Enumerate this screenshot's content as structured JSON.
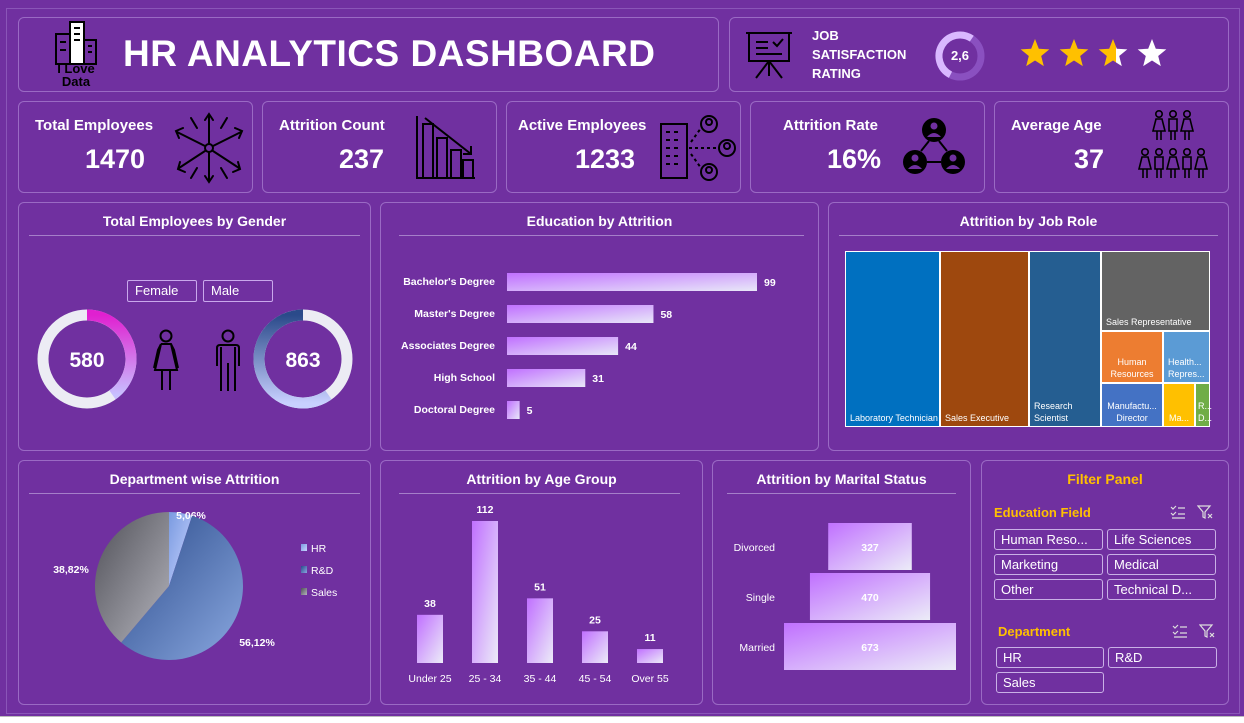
{
  "header": {
    "logo_text_line1": "I Love",
    "logo_text_line2": "Data",
    "title": "HR ANALYTICS DASHBOARD"
  },
  "job_satisfaction": {
    "label_line1": "JOB",
    "label_line2": "SATISFACTION",
    "label_line3": "RATING",
    "value": "2,6",
    "stars_filled": 2.6,
    "stars_total": 4
  },
  "kpis": [
    {
      "title": "Total Employees",
      "value": "1470",
      "icon": "team-hands-icon"
    },
    {
      "title": "Attrition Count",
      "value": "237",
      "icon": "declining-bar-chart-icon"
    },
    {
      "title": "Active Employees",
      "value": "1233",
      "icon": "office-building-people-icon"
    },
    {
      "title": "Attrition Rate",
      "value": "16%",
      "icon": "people-network-icon"
    },
    {
      "title": "Average Age",
      "value": "37",
      "icon": "people-group-icon"
    }
  ],
  "gender_panel": {
    "title": "Total Employees by Gender",
    "female_label": "Female",
    "male_label": "Male",
    "female_value": "580",
    "male_value": "863"
  },
  "education_panel": {
    "title": "Education by Attrition"
  },
  "jobrole_panel": {
    "title": "Attrition by Job Role"
  },
  "department_panel": {
    "title": "Department wise Attrition"
  },
  "age_panel": {
    "title": "Attrition by Age Group"
  },
  "marital_panel": {
    "title": "Attrition by Marital Status"
  },
  "filter_panel": {
    "title": "Filter Panel",
    "education_field_label": "Education Field",
    "education_field_options": [
      "Human Reso...",
      "Life Sciences",
      "Marketing",
      "Medical",
      "Other",
      "Technical D..."
    ],
    "department_label": "Department",
    "department_options": [
      "HR",
      "R&D",
      "Sales"
    ]
  },
  "colors": {
    "background": "#7030a0",
    "accent_orange": "#ffc000",
    "female_pink": "#e040d0",
    "male_blue": "#3a5a9a",
    "star_gold": "#ffc000"
  },
  "chart_data": [
    {
      "type": "pie",
      "chart": "gender-donuts",
      "title": "Total Employees by Gender",
      "series": [
        {
          "name": "Female",
          "value": 580
        },
        {
          "name": "Male",
          "value": 863
        }
      ]
    },
    {
      "type": "bar",
      "chart": "education-by-attrition",
      "title": "Education by Attrition",
      "orientation": "horizontal",
      "categories": [
        "Bachelor's Degree",
        "Master's Degree",
        "Associates Degree",
        "High School",
        "Doctoral Degree"
      ],
      "values": [
        99,
        58,
        44,
        31,
        5
      ]
    },
    {
      "type": "heatmap",
      "chart": "attrition-by-job-role-treemap",
      "title": "Attrition by Job Role",
      "categories": [
        "Laboratory Technician",
        "Sales Executive",
        "Research Scientist",
        "Sales Representative",
        "Human Resources",
        "Healthcare Representative",
        "Manufacturing Director",
        "Manager",
        "Research Director"
      ],
      "labels": [
        "Laboratory Technician",
        "Sales Executive",
        "Research Scientist",
        "Sales Representative",
        "Human Resources",
        "Health... Repres...",
        "Manufactu... Director",
        "Ma...",
        "R... D..."
      ],
      "values": [
        62,
        57,
        47,
        33,
        12,
        9,
        10,
        5,
        2
      ],
      "colors": [
        "#0070c0",
        "#9e480e",
        "#255e91",
        "#636363",
        "#ed7d31",
        "#5b9bd5",
        "#4472c4",
        "#ffc000",
        "#70ad47"
      ]
    },
    {
      "type": "pie",
      "chart": "department-wise-attrition",
      "title": "Department wise Attrition",
      "categories": [
        "HR",
        "R&D",
        "Sales"
      ],
      "values": [
        5.06,
        56.12,
        38.82
      ],
      "labels": [
        "5,06%",
        "56,12%",
        "38,82%"
      ],
      "legend": "right"
    },
    {
      "type": "bar",
      "chart": "attrition-by-age-group",
      "title": "Attrition by Age Group",
      "categories": [
        "Under 25",
        "25 - 34",
        "35 - 44",
        "45 - 54",
        "Over 55"
      ],
      "values": [
        38,
        112,
        51,
        25,
        11
      ]
    },
    {
      "type": "bar",
      "chart": "attrition-by-marital-status",
      "title": "Attrition by Marital Status",
      "orientation": "horizontal-funnel",
      "categories": [
        "Divorced",
        "Single",
        "Married"
      ],
      "values": [
        327,
        470,
        673
      ]
    }
  ]
}
